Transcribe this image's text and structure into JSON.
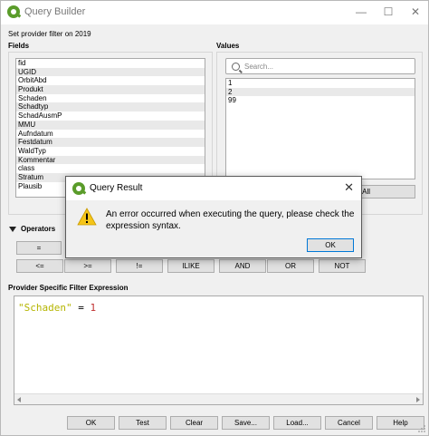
{
  "window": {
    "title": "Query Builder",
    "subtitle": "Set provider filter on 2019",
    "minimize_glyph": "—",
    "maximize_glyph": "☐",
    "close_glyph": "✕"
  },
  "fields": {
    "label": "Fields",
    "items": [
      "fid",
      "UGID",
      "OrbitAbd",
      "Produkt",
      "Schaden",
      "Schadtyp",
      "SchadAusmP",
      "MMU",
      "Aufndatum",
      "Festdatum",
      "WaldTyp",
      "Kommentar",
      "class",
      "Stratum",
      "Plausib"
    ]
  },
  "values": {
    "label": "Values",
    "search_placeholder": "Search...",
    "items": [
      "1",
      "2",
      "99"
    ],
    "all_button_visible_label": "All"
  },
  "operators": {
    "label": "Operators",
    "row1": [
      "="
    ],
    "row2": [
      "<=",
      ">=",
      "!=",
      "ILIKE",
      "AND",
      "OR",
      "NOT"
    ]
  },
  "expression": {
    "label": "Provider Specific Filter Expression",
    "field": "\"Schaden\"",
    "op": " = ",
    "value": "1"
  },
  "bottom_buttons": {
    "ok": "OK",
    "test": "Test",
    "clear": "Clear",
    "save": "Save...",
    "load": "Load...",
    "cancel": "Cancel",
    "help": "Help"
  },
  "dialog": {
    "title": "Query Result",
    "close_glyph": "✕",
    "message": "An error occurred when executing the query, please check the expression syntax.",
    "ok": "OK"
  },
  "colors": {
    "accent_green": "#5a9c2a",
    "expr_string": "#b5b500",
    "expr_number": "#c03030",
    "warning_yellow": "#f5c518"
  }
}
